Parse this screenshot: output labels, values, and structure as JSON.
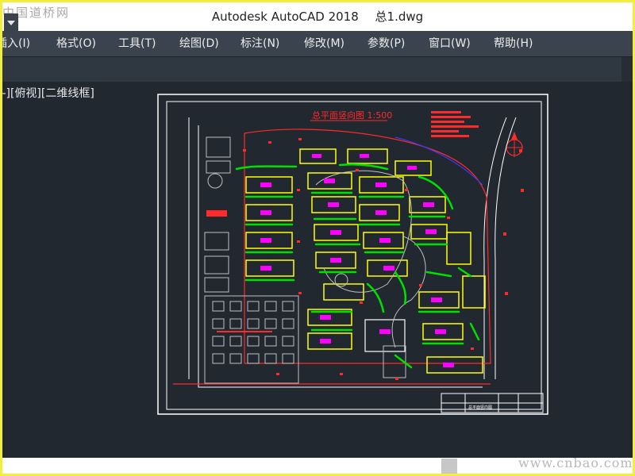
{
  "window": {
    "app_title": "Autodesk AutoCAD 2018",
    "file_name": "总1.dwg",
    "watermark_top": "中国道桥网",
    "watermark_bottom": "www.cnbao.com"
  },
  "menu": {
    "items": [
      {
        "id": "insert",
        "label": "插入(I)"
      },
      {
        "id": "format",
        "label": "格式(O)"
      },
      {
        "id": "tools",
        "label": "工具(T)"
      },
      {
        "id": "draw",
        "label": "绘图(D)"
      },
      {
        "id": "dimension",
        "label": "标注(N)"
      },
      {
        "id": "modify",
        "label": "修改(M)"
      },
      {
        "id": "parameters",
        "label": "参数(P)"
      },
      {
        "id": "window",
        "label": "窗口(W)"
      },
      {
        "id": "help",
        "label": "帮助(H)"
      }
    ]
  },
  "viewport": {
    "label": "[-][俯视][二维线框]"
  },
  "drawing": {
    "title": "总平面竖向图 1:500",
    "title_block_text": "总平面竖向图"
  },
  "colors": {
    "background": "#212830",
    "building_outline": "#ffff00",
    "landscape": "#00e000",
    "annotation": "#ff2a2a",
    "label": "#ff00ff",
    "border": "#ffffff"
  }
}
